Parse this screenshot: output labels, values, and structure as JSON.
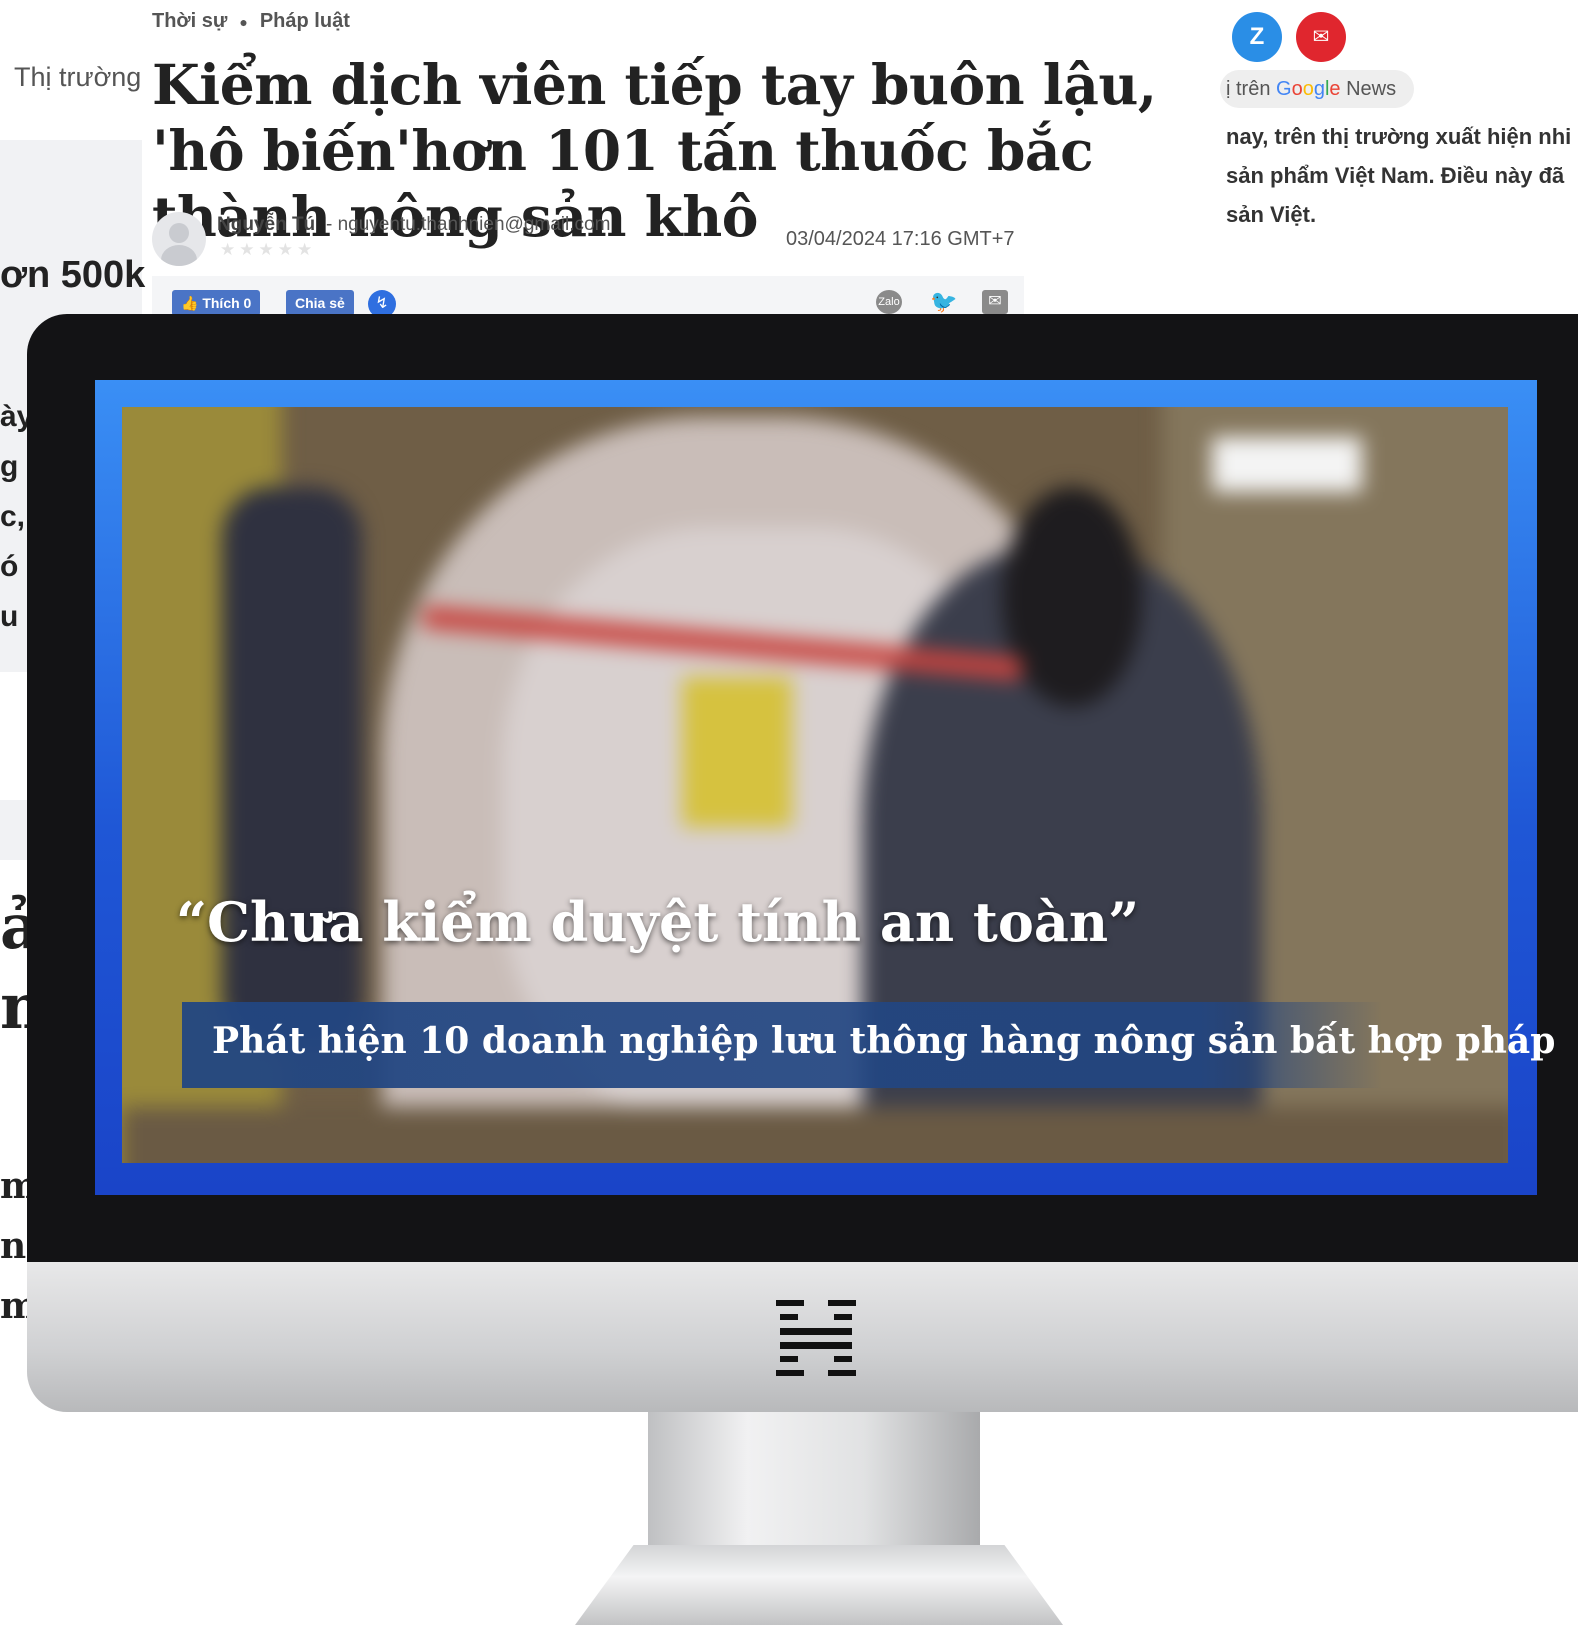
{
  "breadcrumb": {
    "item1": "Thời sự",
    "item2": "Pháp luật"
  },
  "left_column": {
    "category_label": "Thị trường",
    "price_fragment": "ơn 500k",
    "side_fragments": [
      "ày",
      "g",
      "c,",
      "ó",
      "u"
    ],
    "serif_fragments_large": [
      "ải",
      "n"
    ],
    "serif_fragments_small": [
      "m",
      "n",
      "m"
    ]
  },
  "article": {
    "headline": "Kiểm dịch viên tiếp tay buôn lậu, 'hô biến'hơn 101 tấn thuốc bắc thành nông sản khô",
    "author": "Nguyễn Tú",
    "email": "- nguyentu.thanhnien@gmail.com",
    "date": "03/04/2024 17:16 GMT+7",
    "like_label": "Thích 0",
    "share_label": "Chia sẻ"
  },
  "right_column": {
    "google_news_prefix": "ị trên",
    "google_news_brand": "Google",
    "google_news_suffix": "News",
    "lines": [
      "nay, trên thị trường xuất hiện nhi",
      "sản phẩm Việt Nam. Điều này đã",
      "sản Việt."
    ]
  },
  "video": {
    "quote": "“Chưa kiểm duyệt tính an toàn”",
    "caption": "Phát hiện 10 doanh nghiệp lưu thông hàng nông sản bất hợp pháp"
  },
  "icons": {
    "zalo": "zalo-icon",
    "mail": "mail-icon",
    "messenger": "messenger-icon",
    "twitter": "twitter-icon",
    "envelope": "envelope-icon",
    "logo": "h-logo-icon"
  },
  "colors": {
    "screen_frame": "#1f57d6",
    "caption_band": "#224682",
    "zalo": "#2a8ee6",
    "mail": "#e0262e",
    "facebook": "#4a74c6"
  }
}
